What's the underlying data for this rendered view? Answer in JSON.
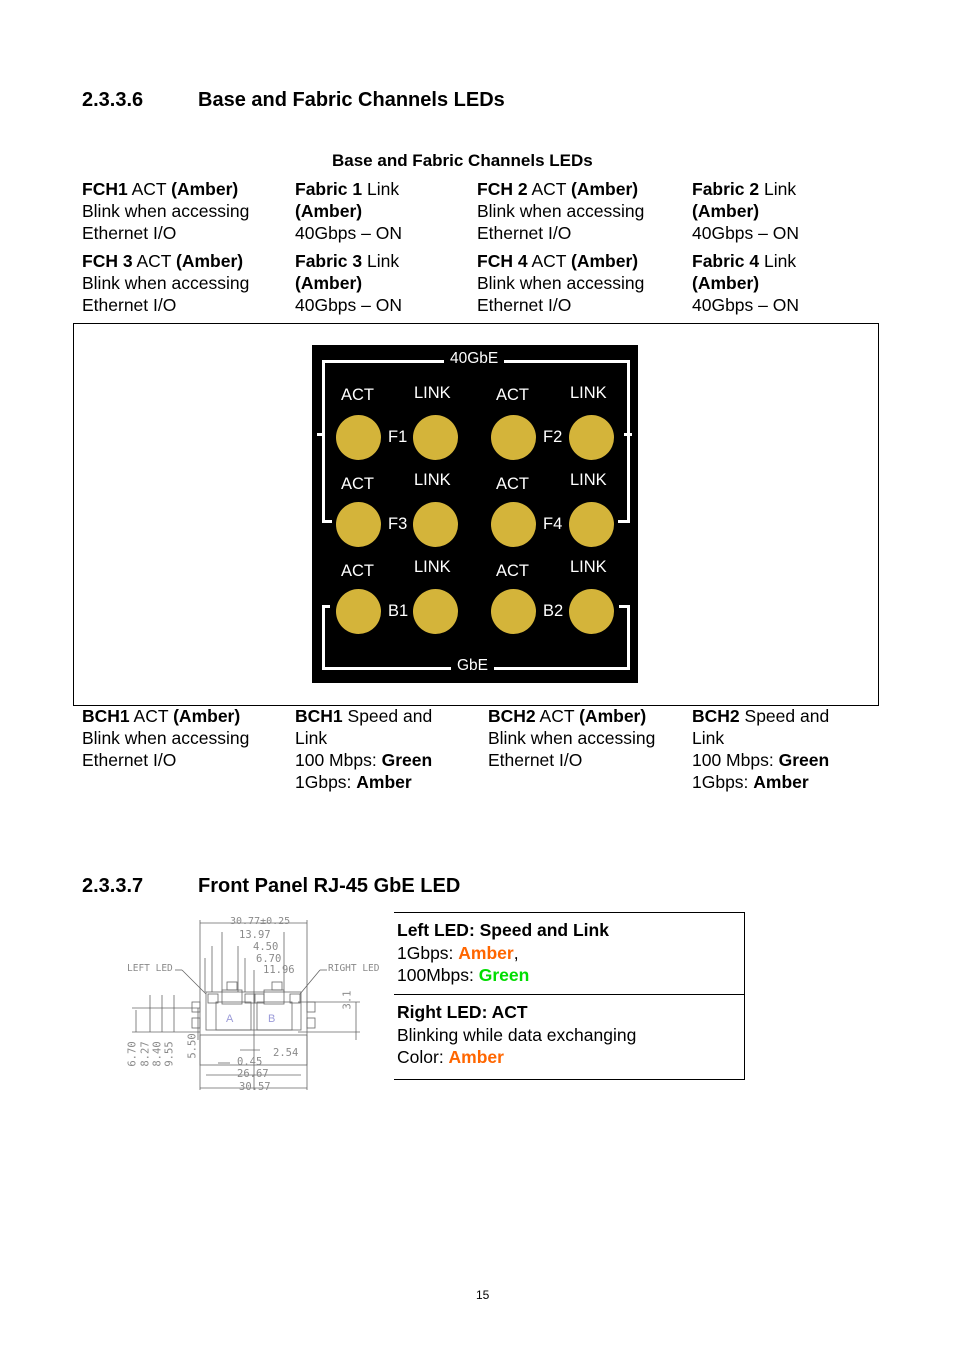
{
  "section1": {
    "number": "2.3.3.6",
    "title": "Base and Fabric Channels LEDs",
    "caption": "Base and Fabric Channels LEDs",
    "top_rows": [
      [
        {
          "bold": "FCH1",
          "normal": " ACT ",
          "bold2": "(Amber)",
          "line2": "Blink when accessing",
          "line3": "Ethernet I/O"
        },
        {
          "bold": "Fabric 1",
          "normal": " Link",
          "line2_bold": "(Amber)",
          "line3": "40Gbps – ON"
        },
        {
          "bold": "FCH 2",
          "normal": " ACT ",
          "bold2": "(Amber)",
          "line2": "Blink when accessing",
          "line3": "Ethernet I/O"
        },
        {
          "bold": "Fabric 2",
          "normal": " Link",
          "line2_bold": "(Amber)",
          "line3": "40Gbps – ON"
        }
      ],
      [
        {
          "bold": "FCH 3",
          "normal": " ACT ",
          "bold2": "(Amber)",
          "line2": "Blink when accessing",
          "line3": "Ethernet I/O"
        },
        {
          "bold": "Fabric 3",
          "normal": " Link",
          "line2_bold": "(Amber)",
          "line3": "40Gbps – ON"
        },
        {
          "bold": "FCH 4",
          "normal": " ACT ",
          "bold2": "(Amber)",
          "line2": "Blink when accessing",
          "line3": "Ethernet I/O"
        },
        {
          "bold": "Fabric 4",
          "normal": " Link",
          "line2_bold": "(Amber)",
          "line3": "40Gbps – ON"
        }
      ]
    ],
    "panel": {
      "led_color": "#d4b43a",
      "top_group": "40GbE",
      "bottom_group": "GbE",
      "act_label": "ACT",
      "link_label": "LINK",
      "ports": [
        "F1",
        "F2",
        "F3",
        "F4",
        "B1",
        "B2"
      ]
    },
    "bottom_row": [
      {
        "bold": "BCH1",
        "normal": " ACT ",
        "bold2": "(Amber)",
        "line2": "Blink when accessing",
        "line3": "Ethernet I/O"
      },
      {
        "bold": "BCH1",
        "normal": " Speed and",
        "line2": "Link",
        "line3": "100 Mbps: ",
        "line3_bold": "Green",
        "line4": "1Gbps: ",
        "line4_bold": "Amber"
      },
      {
        "bold": "BCH2",
        "normal": " ACT ",
        "bold2": "(Amber)",
        "line2": "Blink when accessing",
        "line3": "Ethernet I/O"
      },
      {
        "bold": "BCH2",
        "normal": " Speed and",
        "line2": "Link",
        "line3": "100 Mbps: ",
        "line3_bold": "Green",
        "line4": "1Gbps: ",
        "line4_bold": "Amber"
      }
    ]
  },
  "section2": {
    "number": "2.3.3.7",
    "title": "Front Panel RJ-45 GbE LED",
    "drawing": {
      "left_led": "LEFT  LED",
      "right_led": "RIGHT  LED",
      "port_a": "A",
      "port_b": "B",
      "dims_top": [
        "30.77±0.25",
        "13.97",
        "4.50",
        "6.70",
        "11.96"
      ],
      "dim_side": "3.1",
      "dims_left": [
        "6.70",
        "8.27",
        "8.40",
        "9.55",
        "5.50"
      ],
      "dims_bottom": [
        "2.54",
        "0.45",
        "26.67",
        "30.57"
      ]
    },
    "rows": [
      {
        "title": "Left LED: Speed and Link",
        "l1_text": "1Gbps: ",
        "l1_color": "Amber",
        "l1_tail": ",",
        "l2_text": "100Mbps: ",
        "l2_color": "Green"
      },
      {
        "title": "Right LED: ACT",
        "l1_text": "Blinking while data exchanging",
        "l2_text": "Color: ",
        "l2_color": "Amber"
      }
    ]
  },
  "colors": {
    "amber_text": "#ff6600",
    "green_text": "#00dd00"
  },
  "page_number": "15"
}
